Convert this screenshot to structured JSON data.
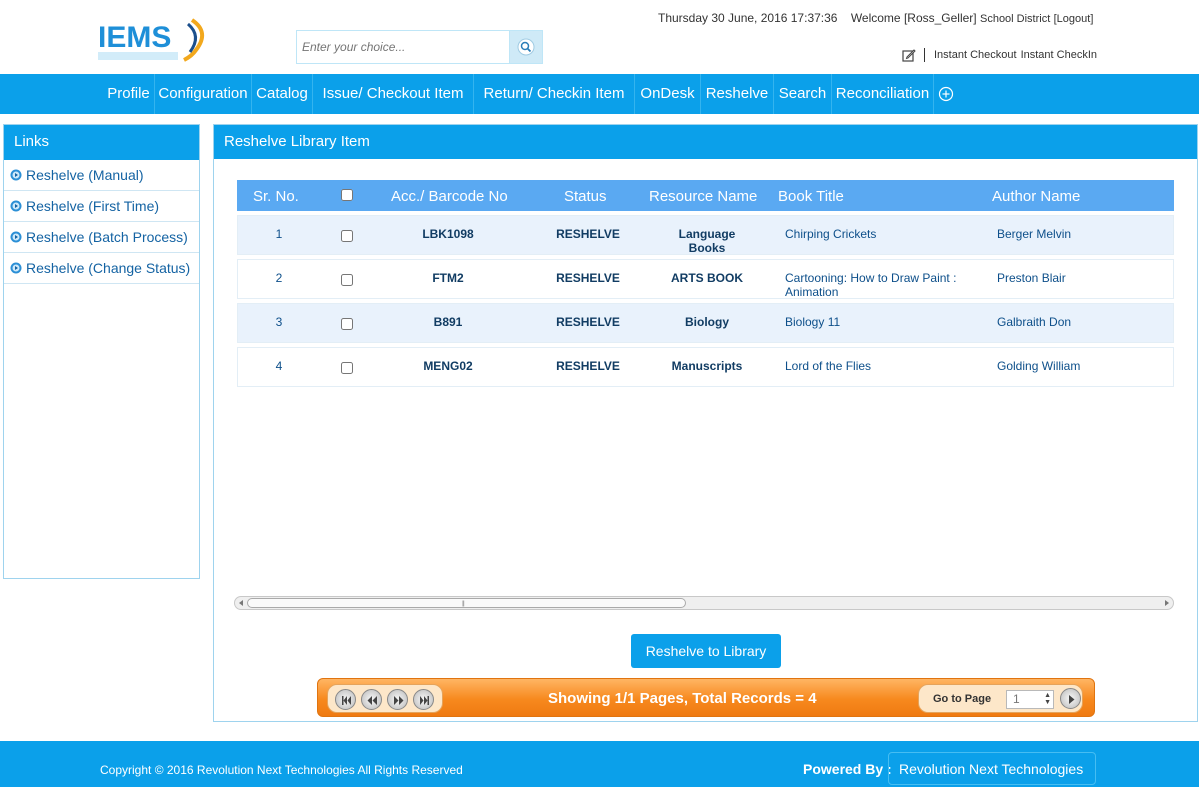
{
  "header": {
    "logo_text": "IEMS",
    "search_placeholder": "Enter your choice...",
    "datetime": "Thursday 30 June, 2016 17:37:36",
    "welcome": "Welcome [Ross_Geller]",
    "district": "School District",
    "logout": "[Logout]",
    "instant_checkout": "Instant Checkout",
    "instant_checkin": "Instant CheckIn"
  },
  "nav": [
    {
      "label": "Profile"
    },
    {
      "label": "Configuration"
    },
    {
      "label": "Catalog"
    },
    {
      "label": "Issue/ Checkout Item"
    },
    {
      "label": "Return/ Checkin Item"
    },
    {
      "label": "OnDesk"
    },
    {
      "label": "Reshelve"
    },
    {
      "label": "Search"
    },
    {
      "label": "Reconciliation"
    }
  ],
  "sidebar": {
    "title": "Links",
    "items": [
      {
        "label": "Reshelve (Manual)"
      },
      {
        "label": "Reshelve (First Time)"
      },
      {
        "label": "Reshelve (Batch Process)"
      },
      {
        "label": "Reshelve (Change Status)"
      }
    ]
  },
  "main": {
    "title": "Reshelve Library Item",
    "columns": [
      "Sr. No.",
      "Acc./ Barcode No",
      "Status",
      "Resource Name",
      "Book Title",
      "Author Name"
    ],
    "rows": [
      {
        "sr": "1",
        "barcode": "LBK1098",
        "status": "RESHELVE",
        "resource": "Language Books",
        "title": "Chirping Crickets",
        "author": "Berger Melvin"
      },
      {
        "sr": "2",
        "barcode": "FTM2",
        "status": "RESHELVE",
        "resource": "ARTS BOOK",
        "title": "Cartooning: How to Draw Paint : Animation",
        "author": "Preston Blair"
      },
      {
        "sr": "3",
        "barcode": "B891",
        "status": "RESHELVE",
        "resource": "Biology",
        "title": "Biology 11",
        "author": "Galbraith Don"
      },
      {
        "sr": "4",
        "barcode": "MENG02",
        "status": "RESHELVE",
        "resource": "Manuscripts",
        "title": "Lord of the Flies",
        "author": "Golding William"
      }
    ],
    "action_button": "Reshelve to Library",
    "pager": {
      "info": "Showing 1/1  Pages, Total Records = 4",
      "goto_label": "Go to Page",
      "page_value": "1"
    }
  },
  "footer": {
    "copyright": "Copyright © 2016 Revolution Next Technologies All Rights Reserved",
    "powered_label": "Powered By :",
    "powered_by": "Revolution Next Technologies"
  },
  "colors": {
    "primary": "#0ba0ea",
    "grid_header": "#5aa9f2",
    "pager_orange": "#f7891e"
  }
}
